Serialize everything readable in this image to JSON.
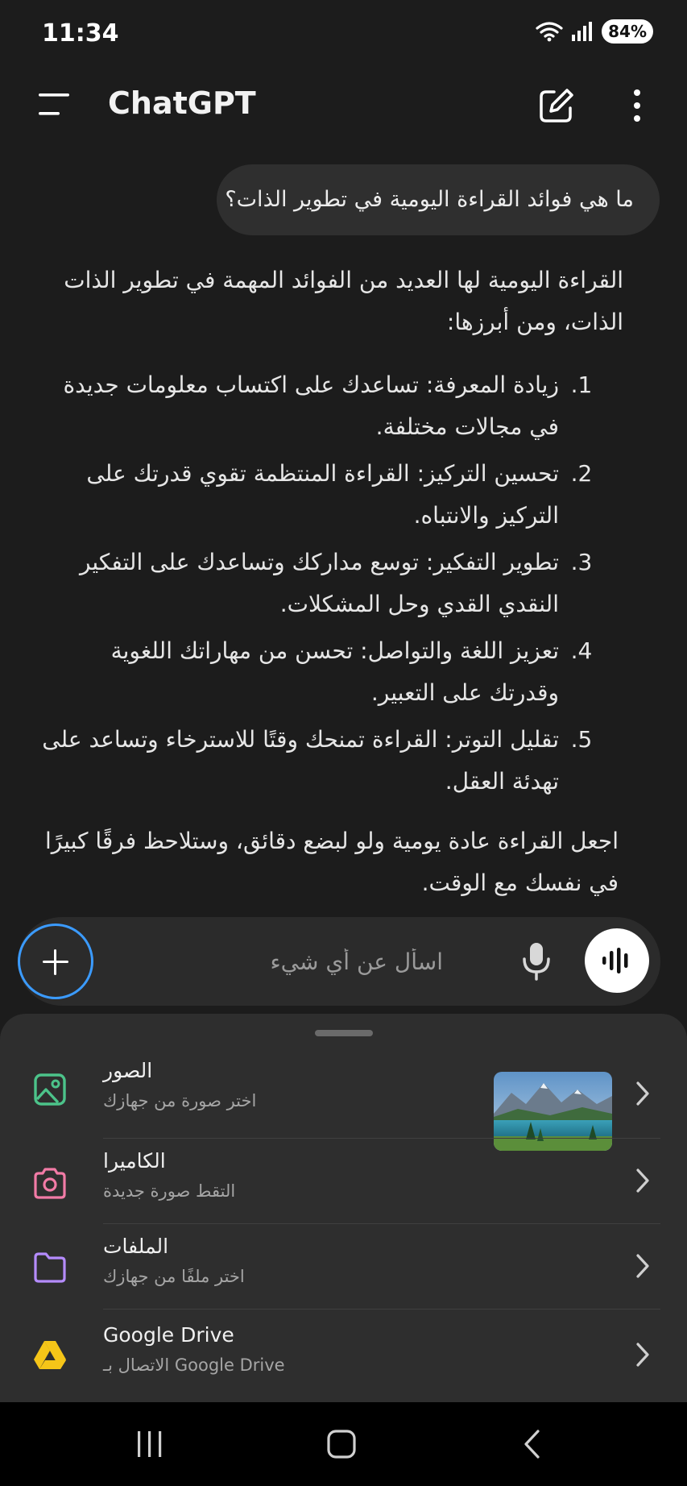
{
  "status_bar": {
    "time": "11:34",
    "battery": "84%"
  },
  "app_bar": {
    "title": "ChatGPT"
  },
  "chat": {
    "user_message": "ما هي فوائد القراءة اليومية في تطوير الذات؟",
    "intro": "القراءة اليومية لها العديد من الفوائد المهمة في تطوير الذات الذات، ومن أبرزها:",
    "points": [
      {
        "num": "1.",
        "text": "زيادة المعرفة: تساعدك على اكتساب معلومات جديدة في مجالات مختلفة."
      },
      {
        "num": "2.",
        "text": "تحسين التركيز: القراءة المنتظمة تقوي قدرتك على التركيز والانتباه."
      },
      {
        "num": "3.",
        "text": "تطوير التفكير: توسع مداركك وتساعدك على التفكير النقدي القدي وحل المشكلات."
      },
      {
        "num": "4.",
        "text": "تعزيز اللغة والتواصل: تحسن من مهاراتك اللغوية وقدرتك على التعبير."
      },
      {
        "num": "5.",
        "text": "تقليل التوتر: القراءة تمنحك وقتًا للاسترخاء وتساعد على تهدئة العقل."
      }
    ],
    "outro": "اجعل القراءة عادة يومية ولو لبضع دقائق، وستلاحظ فرقًا كبيرًا في نفسك مع الوقت."
  },
  "composer": {
    "placeholder": "اسأل عن أي شيء"
  },
  "attach_sheet": {
    "items": [
      {
        "title": "الصور",
        "subtitle": "اختر صورة من جهازك",
        "icon": "image-icon"
      },
      {
        "title": "الكاميرا",
        "subtitle": "التقط صورة جديدة",
        "icon": "camera-icon"
      },
      {
        "title": "الملفات",
        "subtitle": "اختر ملفًا من جهازك",
        "icon": "folder-icon"
      },
      {
        "title": "Google Drive",
        "subtitle": "الاتصال بـ Google Drive",
        "icon": "google-drive-icon"
      }
    ]
  },
  "colors": {
    "background": "#1c1c1c",
    "bubble": "#2f2f2f",
    "sheet": "#2e2e2e",
    "accent_ring": "#3b9bff",
    "photos_icon": "#4cc38a",
    "camera_icon": "#f27ba6",
    "files_icon": "#b58cff",
    "drive_icon": "#f5c518"
  }
}
